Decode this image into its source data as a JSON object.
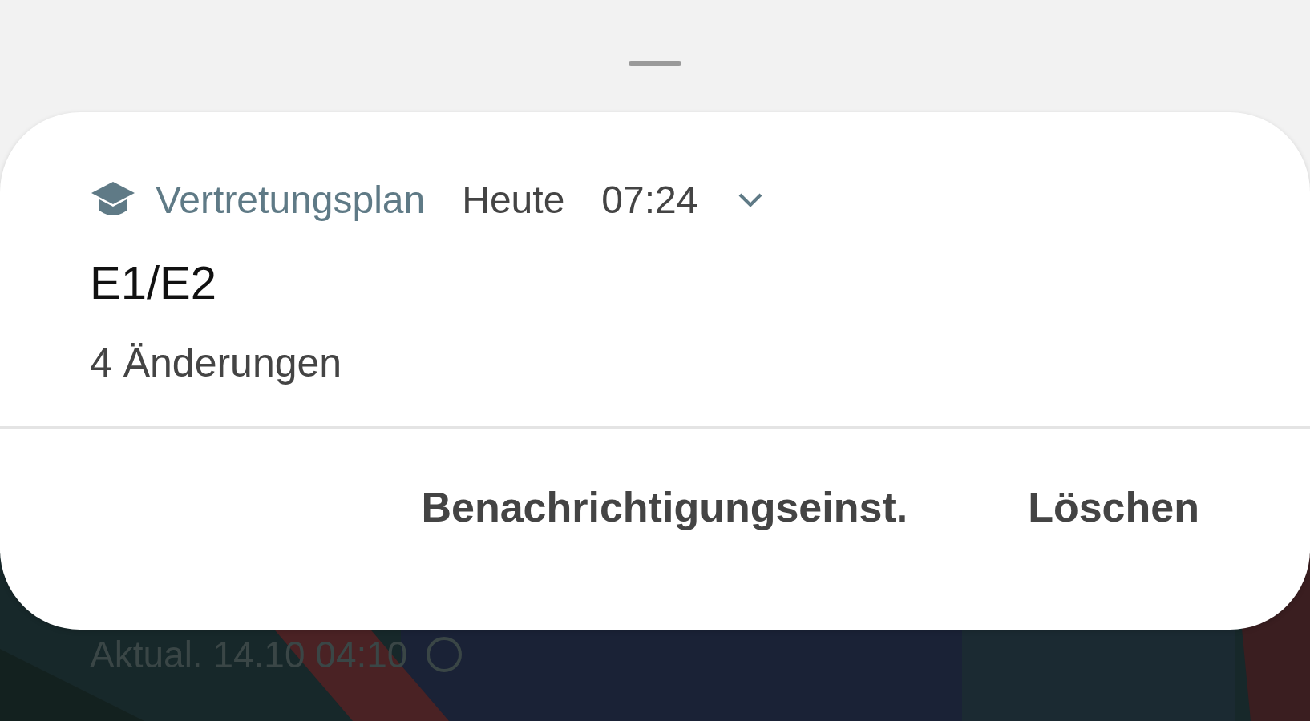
{
  "notification": {
    "app_name": "Vertretungsplan",
    "day": "Heute",
    "time": "07:24",
    "expanded": false,
    "title": "E1/E2",
    "text": "4 Änderungen"
  },
  "actions": [
    {
      "label": "Benachrichtigungseinst."
    },
    {
      "label": "Löschen"
    }
  ],
  "background": {
    "kind": "picture",
    "status_text": "Aktual. 14.10 04:10"
  }
}
